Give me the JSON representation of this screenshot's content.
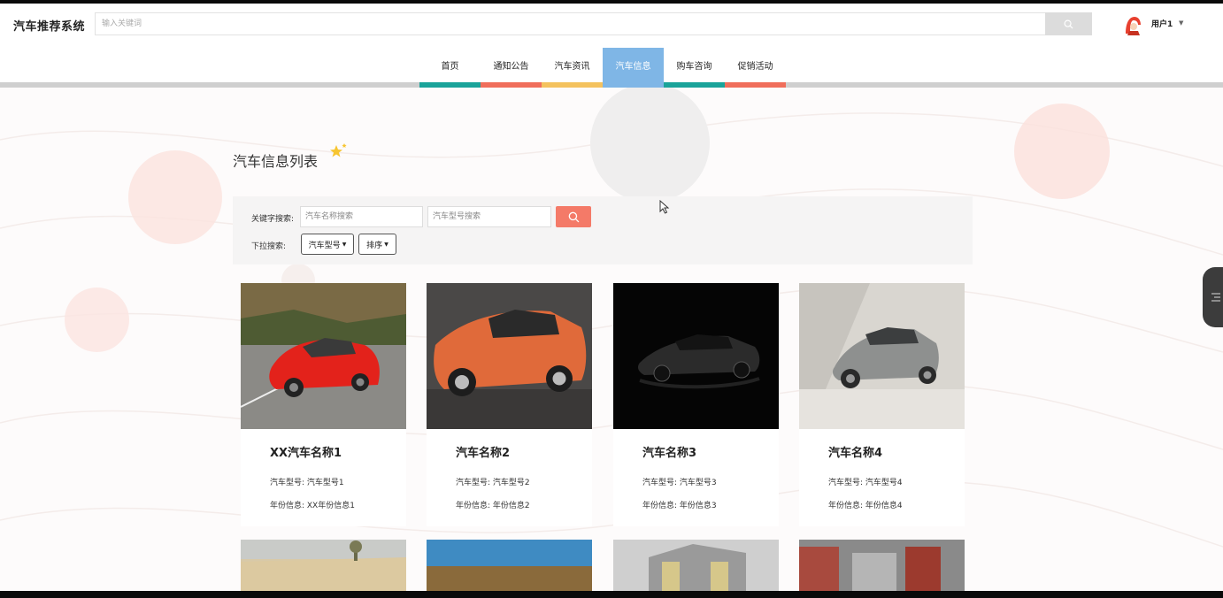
{
  "header": {
    "logo": "汽车推荐系统",
    "search_placeholder": "输入关键词",
    "user_name": "用户1"
  },
  "nav": {
    "items": [
      {
        "label": "首页",
        "color": "#1aa39a"
      },
      {
        "label": "通知公告",
        "color": "#f06e5b"
      },
      {
        "label": "汽车资讯",
        "color": "#f4c25e"
      },
      {
        "label": "汽车信息",
        "color": "#7fb6e6",
        "active": true
      },
      {
        "label": "购车咨询",
        "color": "#1aa39a"
      },
      {
        "label": "促销活动",
        "color": "#f06e5b"
      }
    ]
  },
  "page": {
    "title": "汽车信息列表"
  },
  "filter": {
    "keyword_label": "关键字搜索:",
    "name_placeholder": "汽车名称搜索",
    "model_placeholder": "汽车型号搜索",
    "dropdown_label": "下拉搜索:",
    "model_dropdown": "汽车型号",
    "sort_dropdown": "排序"
  },
  "cards": [
    {
      "name": "XX汽车名称1",
      "model_line": "汽车型号: 汽车型号1",
      "year_line": "年份信息: XX年份信息1"
    },
    {
      "name": "汽车名称2",
      "model_line": "汽车型号: 汽车型号2",
      "year_line": "年份信息: 年份信息2"
    },
    {
      "name": "汽车名称3",
      "model_line": "汽车型号: 汽车型号3",
      "year_line": "年份信息: 年份信息3"
    },
    {
      "name": "汽车名称4",
      "model_line": "汽车型号: 汽车型号4",
      "year_line": "年份信息: 年份信息4"
    }
  ],
  "colors": {
    "accent_red": "#f47a68",
    "nav_active": "#7fb6e6"
  },
  "icons": {
    "search": "search-icon",
    "star": "star-icon",
    "side": "list-icon"
  }
}
